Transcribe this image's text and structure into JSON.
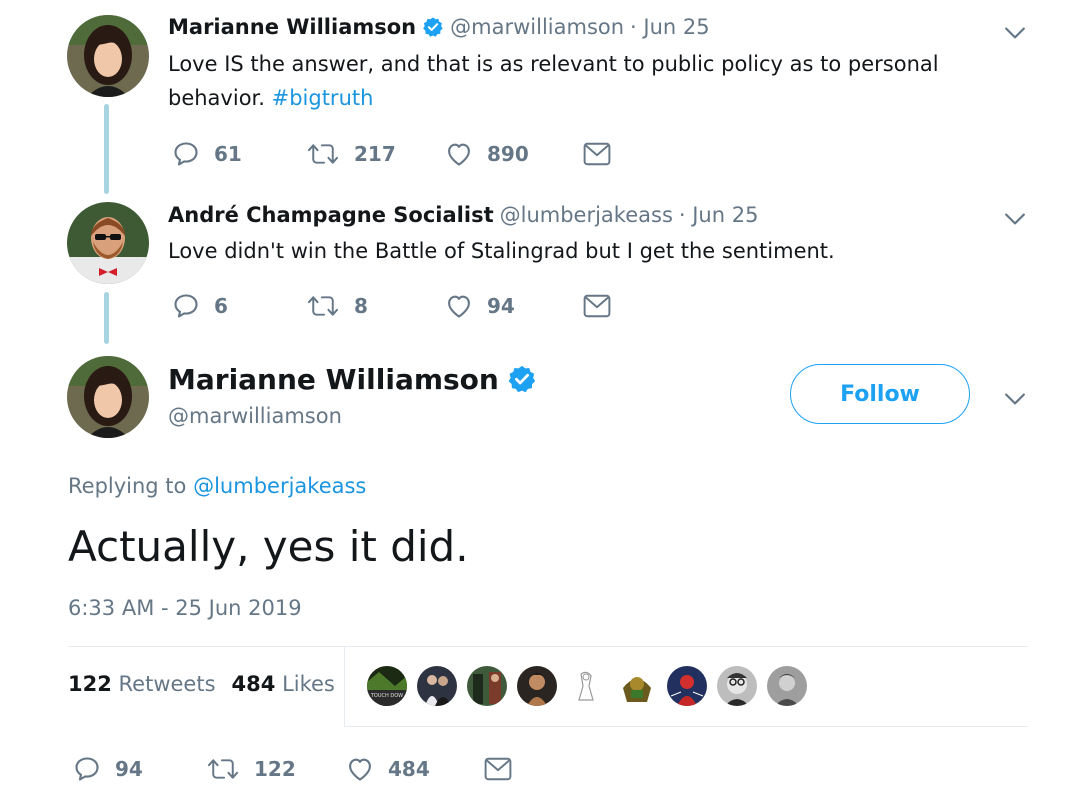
{
  "tweet1": {
    "name": "Marianne Williamson",
    "handle": "@marwilliamson",
    "date": "· Jun 25",
    "text_line1": "Love IS the answer, and that is as relevant to public policy as to personal",
    "text_line2": "behavior.",
    "hashtag": "#bigtruth",
    "replies": "61",
    "retweets": "217",
    "likes": "890"
  },
  "tweet2": {
    "name": "André Champagne Socialist",
    "handle": "@lumberjakeass",
    "date": "· Jun 25",
    "text": "Love didn't win the Battle of Stalingrad but I get the sentiment.",
    "replies": "6",
    "retweets": "8",
    "likes": "94"
  },
  "main_tweet": {
    "name": "Marianne Williamson",
    "handle": "@marwilliamson",
    "follow_label": "Follow",
    "replying_prefix": "Replying to",
    "replying_handle": "@lumberjakeass",
    "text": "Actually, yes it did.",
    "timestamp": "6:33 AM - 25 Jun 2019",
    "retweet_count": "122",
    "retweet_label": "Retweets",
    "like_count": "484",
    "like_label": "Likes",
    "liker_overlay_text": "TOUCH DOW",
    "replies": "94",
    "retweets": "122",
    "likes": "484"
  },
  "colors": {
    "accent": "#1da1f2",
    "link": "#1b95e0",
    "muted": "#657786",
    "thread_line": "#a6d4e1"
  },
  "icons": [
    "reply-icon",
    "retweet-icon",
    "like-icon",
    "message-icon",
    "chevron-down-icon",
    "verified-badge-icon"
  ]
}
